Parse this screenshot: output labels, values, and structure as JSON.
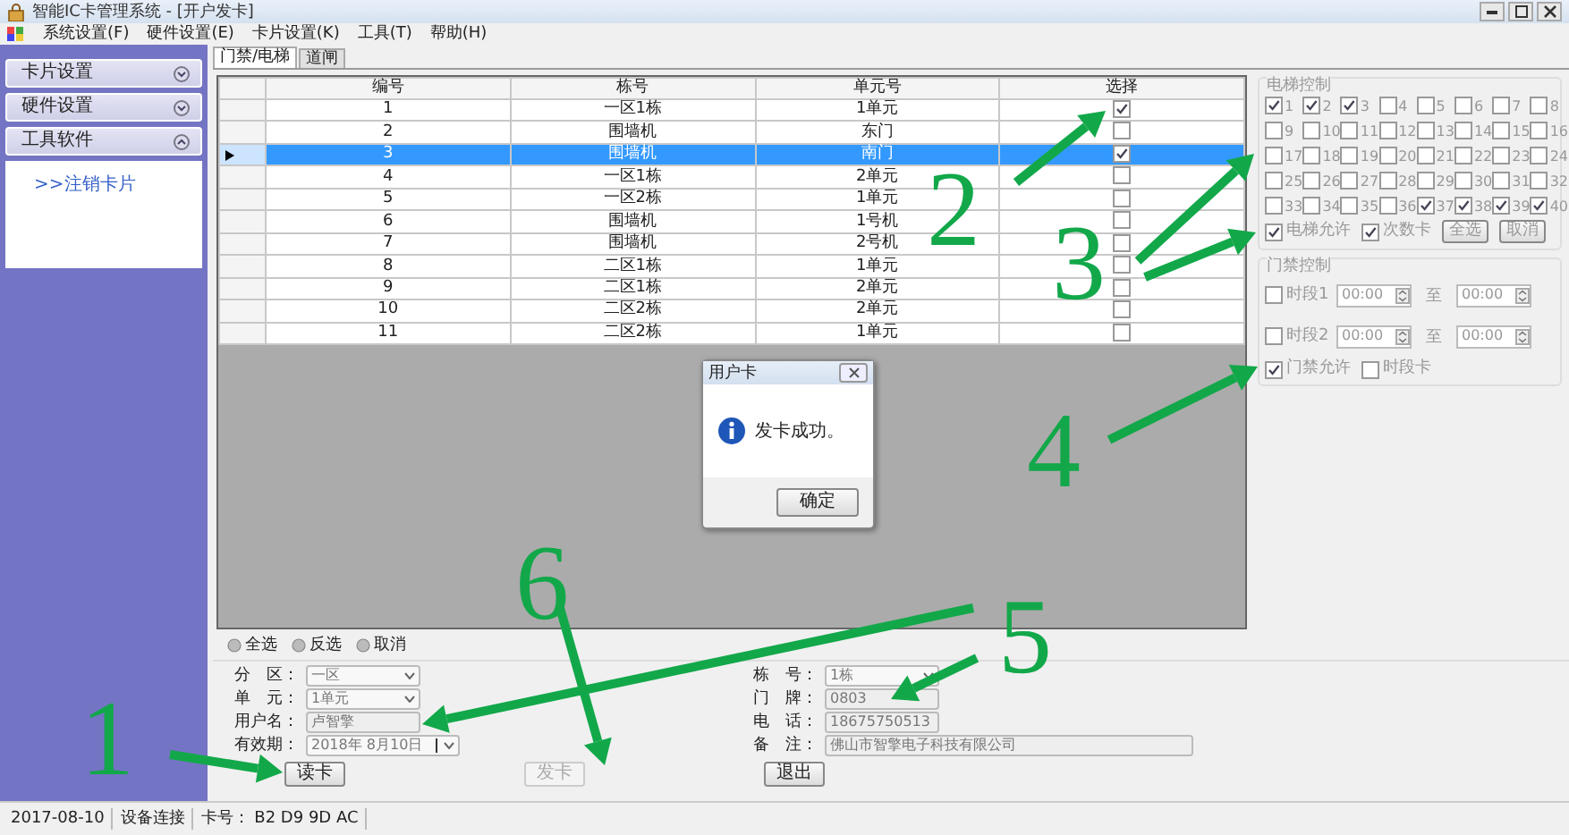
{
  "window": {
    "title": "智能IC卡管理系统 - [开户发卡]"
  },
  "menu": [
    "系统设置(F)",
    "硬件设置(E)",
    "卡片设置(K)",
    "工具(T)",
    "帮助(H)"
  ],
  "sidebar": {
    "groups": [
      {
        "label": "卡片设置",
        "expanded": false
      },
      {
        "label": "硬件设置",
        "expanded": false
      },
      {
        "label": "工具软件",
        "expanded": true,
        "items": [
          ">>注销卡片"
        ]
      }
    ]
  },
  "tabs": [
    {
      "label": "门禁/电梯",
      "selected": true
    },
    {
      "label": "道闸",
      "selected": false
    }
  ],
  "table": {
    "columns": [
      "编号",
      "栋号",
      "单元号",
      "选择"
    ],
    "rows": [
      {
        "cells": [
          "1",
          "一区1栋",
          "1单元"
        ],
        "checked": true,
        "selected": false
      },
      {
        "cells": [
          "2",
          "围墙机",
          "东门"
        ],
        "checked": false,
        "selected": false
      },
      {
        "cells": [
          "3",
          "围墙机",
          "南门"
        ],
        "checked": true,
        "selected": true
      },
      {
        "cells": [
          "4",
          "一区1栋",
          "2单元"
        ],
        "checked": false,
        "selected": false
      },
      {
        "cells": [
          "5",
          "一区2栋",
          "1单元"
        ],
        "checked": false,
        "selected": false
      },
      {
        "cells": [
          "6",
          "围墙机",
          "1号机"
        ],
        "checked": false,
        "selected": false
      },
      {
        "cells": [
          "7",
          "围墙机",
          "2号机"
        ],
        "checked": false,
        "selected": false
      },
      {
        "cells": [
          "8",
          "二区1栋",
          "1单元"
        ],
        "checked": false,
        "selected": false
      },
      {
        "cells": [
          "9",
          "二区1栋",
          "2单元"
        ],
        "checked": false,
        "selected": false
      },
      {
        "cells": [
          "10",
          "二区2栋",
          "2单元"
        ],
        "checked": false,
        "selected": false
      },
      {
        "cells": [
          "11",
          "二区2栋",
          "1单元"
        ],
        "checked": false,
        "selected": false
      }
    ]
  },
  "elevator_control": {
    "title": "电梯控制",
    "disabled": true,
    "floors": [
      {
        "label": "1",
        "checked": true
      },
      {
        "label": "2",
        "checked": true
      },
      {
        "label": "3",
        "checked": true
      },
      {
        "label": "4",
        "checked": false
      },
      {
        "label": "5",
        "checked": false
      },
      {
        "label": "6",
        "checked": false
      },
      {
        "label": "7",
        "checked": false
      },
      {
        "label": "8",
        "checked": false
      },
      {
        "label": "9",
        "checked": false
      },
      {
        "label": "10",
        "checked": false
      },
      {
        "label": "11",
        "checked": false
      },
      {
        "label": "12",
        "checked": false
      },
      {
        "label": "13",
        "checked": false
      },
      {
        "label": "14",
        "checked": false
      },
      {
        "label": "15",
        "checked": false
      },
      {
        "label": "16",
        "checked": false
      },
      {
        "label": "17",
        "checked": false
      },
      {
        "label": "18",
        "checked": false
      },
      {
        "label": "19",
        "checked": false
      },
      {
        "label": "20",
        "checked": false
      },
      {
        "label": "21",
        "checked": false
      },
      {
        "label": "22",
        "checked": false
      },
      {
        "label": "23",
        "checked": false
      },
      {
        "label": "24",
        "checked": false
      },
      {
        "label": "25",
        "checked": false
      },
      {
        "label": "26",
        "checked": false
      },
      {
        "label": "27",
        "checked": false
      },
      {
        "label": "28",
        "checked": false
      },
      {
        "label": "29",
        "checked": false
      },
      {
        "label": "30",
        "checked": false
      },
      {
        "label": "31",
        "checked": false
      },
      {
        "label": "32",
        "checked": false
      },
      {
        "label": "33",
        "checked": false
      },
      {
        "label": "34",
        "checked": false
      },
      {
        "label": "35",
        "checked": false
      },
      {
        "label": "36",
        "checked": false
      },
      {
        "label": "37",
        "checked": true
      },
      {
        "label": "38",
        "checked": true
      },
      {
        "label": "39",
        "checked": true
      },
      {
        "label": "40",
        "checked": true
      }
    ],
    "options": [
      {
        "label": "电梯允许",
        "checked": true
      },
      {
        "label": "次数卡",
        "checked": true
      }
    ],
    "buttons": [
      "全选",
      "取消"
    ]
  },
  "access_control": {
    "title": "门禁控制",
    "disabled": true,
    "periods": [
      {
        "label": "时段1",
        "checked": false,
        "from": "00:00",
        "separator": "至",
        "to": "00:00"
      },
      {
        "label": "时段2",
        "checked": false,
        "from": "00:00",
        "separator": "至",
        "to": "00:00"
      }
    ],
    "options": [
      {
        "label": "门禁允许",
        "checked": true
      },
      {
        "label": "时段卡",
        "checked": false
      }
    ]
  },
  "selection_bar": [
    {
      "label": "全选",
      "selected": false
    },
    {
      "label": "反选",
      "selected": false
    },
    {
      "label": "取消",
      "selected": false
    }
  ],
  "form": {
    "left": [
      {
        "label": "分　区：",
        "value": "一区",
        "kind": "dropdown"
      },
      {
        "label": "单　元：",
        "value": "1单元",
        "kind": "dropdown"
      },
      {
        "label": "用户名：",
        "value": "卢智擎",
        "kind": "text"
      },
      {
        "label": "有效期：",
        "value": "2018年 8月10日",
        "kind": "date"
      }
    ],
    "right": [
      {
        "label": "栋　号：",
        "value": "1栋",
        "kind": "dropdown"
      },
      {
        "label": "门　牌：",
        "value": "0803",
        "kind": "text"
      },
      {
        "label": "电　话：",
        "value": "18675750513",
        "kind": "text"
      },
      {
        "label": "备　注：",
        "value": "佛山市智擎电子科技有限公司",
        "kind": "wide"
      }
    ]
  },
  "buttons": [
    {
      "label": "读卡",
      "disabled": false
    },
    {
      "label": "发卡",
      "disabled": true
    },
    {
      "label": "退出",
      "disabled": false
    }
  ],
  "dialog": {
    "title": "用户卡",
    "message": "发卡成功。",
    "button": "确定"
  },
  "status_bar": [
    "2017-08-10",
    "设备连接",
    "卡号： B2 D9 9D AC"
  ],
  "annotations": [
    {
      "label": "1"
    },
    {
      "label": "2"
    },
    {
      "label": "3"
    },
    {
      "label": "4"
    },
    {
      "label": "5"
    },
    {
      "label": "6"
    }
  ]
}
